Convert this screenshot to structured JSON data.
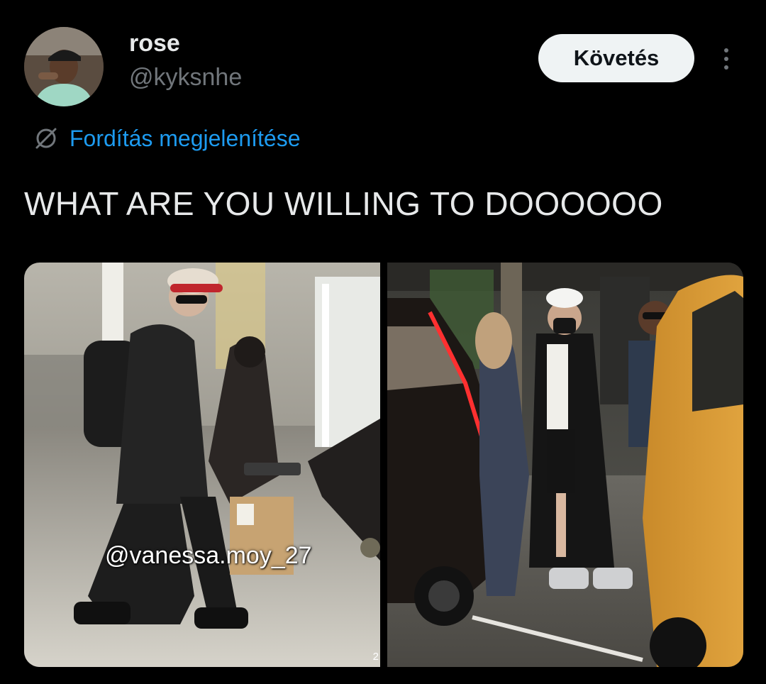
{
  "author": {
    "display_name": "rose",
    "handle": "@kyksnhe",
    "avatar_icon": "profile-avatar"
  },
  "actions": {
    "follow_label": "Követés",
    "more_icon": "more-vertical-icon"
  },
  "translate": {
    "label": "Fordítás megjelenítése",
    "icon": "globe-slash-icon",
    "color": "#1d9bf0"
  },
  "tweet": {
    "text": "WHAT ARE YOU WILLING TO DOOOOOO"
  },
  "media": {
    "left": {
      "watermark": "@vanessa.moy_27",
      "corner_text": "2"
    },
    "right": {}
  },
  "colors": {
    "background": "#000000",
    "text_primary": "#e7e9ea",
    "text_secondary": "#71767b",
    "button_bg": "#eff3f4",
    "button_text": "#0f1419"
  }
}
